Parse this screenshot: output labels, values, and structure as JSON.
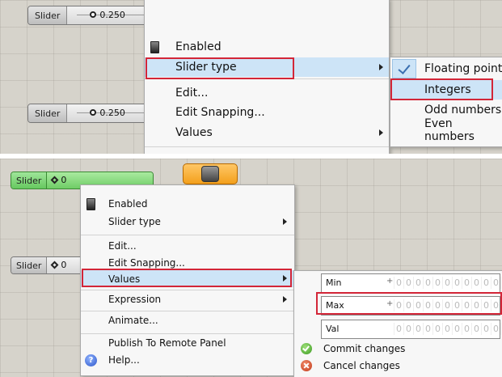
{
  "top": {
    "slider1": {
      "label": "Slider",
      "value": "0.250"
    },
    "slider2": {
      "label": "Slider",
      "value": "0.250"
    },
    "menu": {
      "items": [
        "Enabled",
        "Slider type",
        "Edit...",
        "Edit Snapping...",
        "Values"
      ],
      "highlighted": "Slider type"
    },
    "submenu": {
      "items": [
        "Floating point",
        "Integers",
        "Odd numbers",
        "Even numbers"
      ],
      "checked": "Floating point",
      "highlighted": "Integers"
    }
  },
  "bottom": {
    "slider1": {
      "label": "Slider",
      "value": "0"
    },
    "slider2": {
      "label": "Slider",
      "value": "0"
    },
    "menu": {
      "items": [
        "Enabled",
        "Slider type",
        "Edit...",
        "Edit Snapping...",
        "Values",
        "Expression",
        "Animate...",
        "Publish To Remote Panel",
        "Help..."
      ],
      "highlighted": "Values"
    },
    "values_panel": {
      "fields": [
        {
          "label": "Min",
          "sign": "+",
          "value": "0"
        },
        {
          "label": "Max",
          "sign": "+",
          "value": "1"
        },
        {
          "label": "Val",
          "sign": "",
          "value": "0"
        }
      ],
      "commit_label": "Commit changes",
      "cancel_label": "Cancel changes"
    }
  },
  "colors": {
    "highlight": "#cde4f7",
    "callout": "#d32638",
    "canvas": "#d6d3cb",
    "component": "#f3a01c",
    "active_slider": "#6fcd66"
  }
}
